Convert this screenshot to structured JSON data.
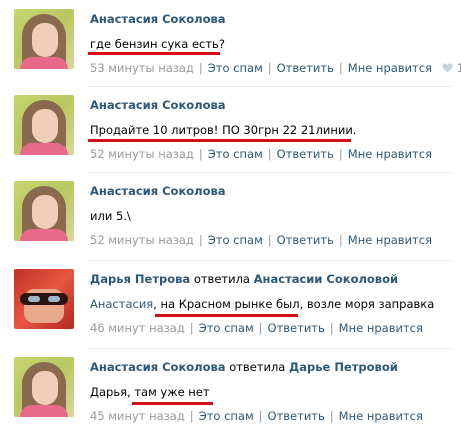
{
  "comments": [
    {
      "author": "Анастасия Соколова",
      "text": "где бензин сука есть?",
      "time": "53 минуты назад",
      "actions": [
        "Это спам",
        "Ответить",
        "Мне нравится"
      ],
      "likes": "1"
    },
    {
      "author": "Анастасия Соколова",
      "text": "Продайте 10 литров! ПО 30грн 22 21линии.",
      "time": "52 минуты назад",
      "actions": [
        "Это спам",
        "Ответить",
        "Мне нравится"
      ]
    },
    {
      "author": "Анастасия Соколова",
      "text": "или 5.\\",
      "time": "52 минуты назад",
      "actions": [
        "Это спам",
        "Ответить",
        "Мне нравится"
      ]
    },
    {
      "author": "Дарья Петрова",
      "reply_word": "ответила",
      "reply_to": "Анастасии Соколовой",
      "mention": "Анастасия",
      "text": ", на Красном рынке был, возле моря заправка",
      "time": "46 минут назад",
      "actions": [
        "Это спам",
        "Ответить",
        "Мне нравится"
      ]
    },
    {
      "author": "Анастасия Соколова",
      "reply_word": "ответила",
      "reply_to": "Дарье Петровой",
      "text": "Дарья, там уже нет",
      "time": "45 минут назад",
      "actions": [
        "Это спам",
        "Ответить",
        "Мне нравится"
      ]
    }
  ],
  "colors": {
    "link": "#2b587a",
    "meta": "#999999",
    "underline": "#d80f1a"
  }
}
